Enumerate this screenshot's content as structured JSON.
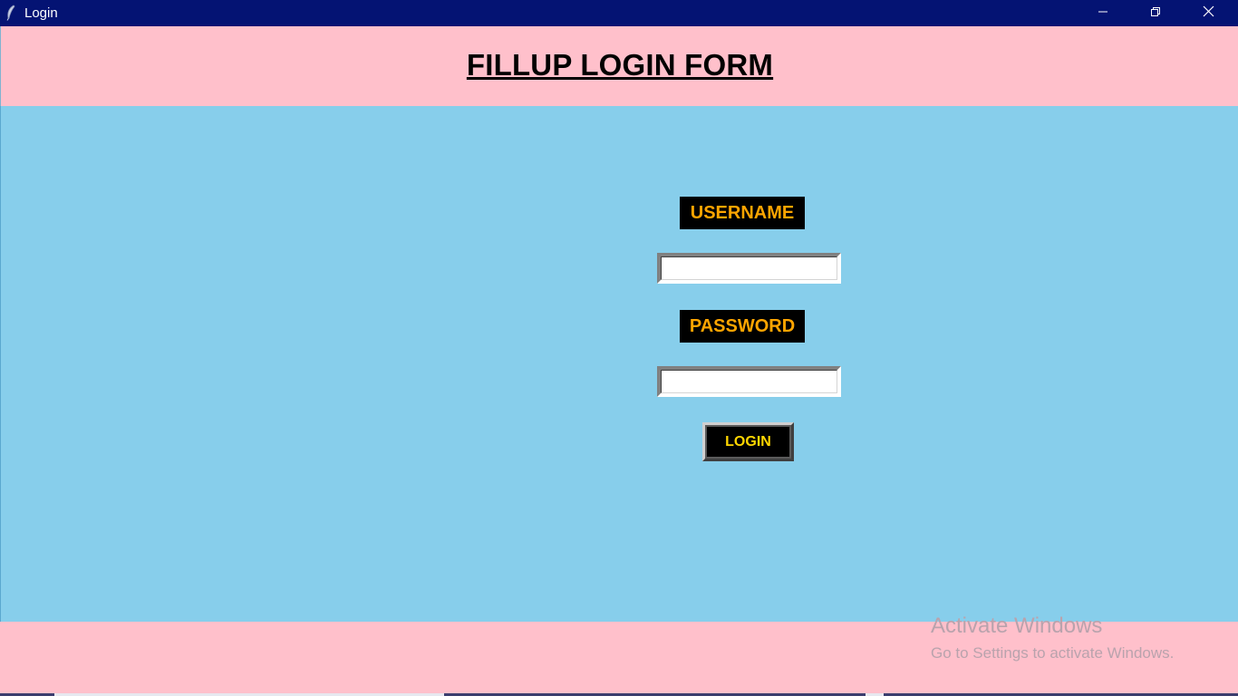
{
  "window": {
    "title": "Login",
    "controls": [
      "minimize",
      "restore",
      "close"
    ]
  },
  "header": {
    "title": "FILLUP LOGIN FORM"
  },
  "form": {
    "username_label": "USERNAME",
    "username_value": "",
    "password_label": "PASSWORD",
    "password_value": "",
    "login_button": "LOGIN"
  },
  "watermark": {
    "title": "Activate Windows",
    "subtitle": "Go to Settings to activate Windows."
  },
  "colors": {
    "titlebar": "#041373",
    "header_bg": "#ffc0cb",
    "main_bg": "#87ceeb",
    "label_bg": "#000000",
    "label_text": "#ffa500",
    "button_text": "#ffd700"
  },
  "icons": {
    "app": "feather-icon",
    "minimize": "minimize-icon",
    "restore": "restore-icon",
    "close": "close-icon"
  }
}
